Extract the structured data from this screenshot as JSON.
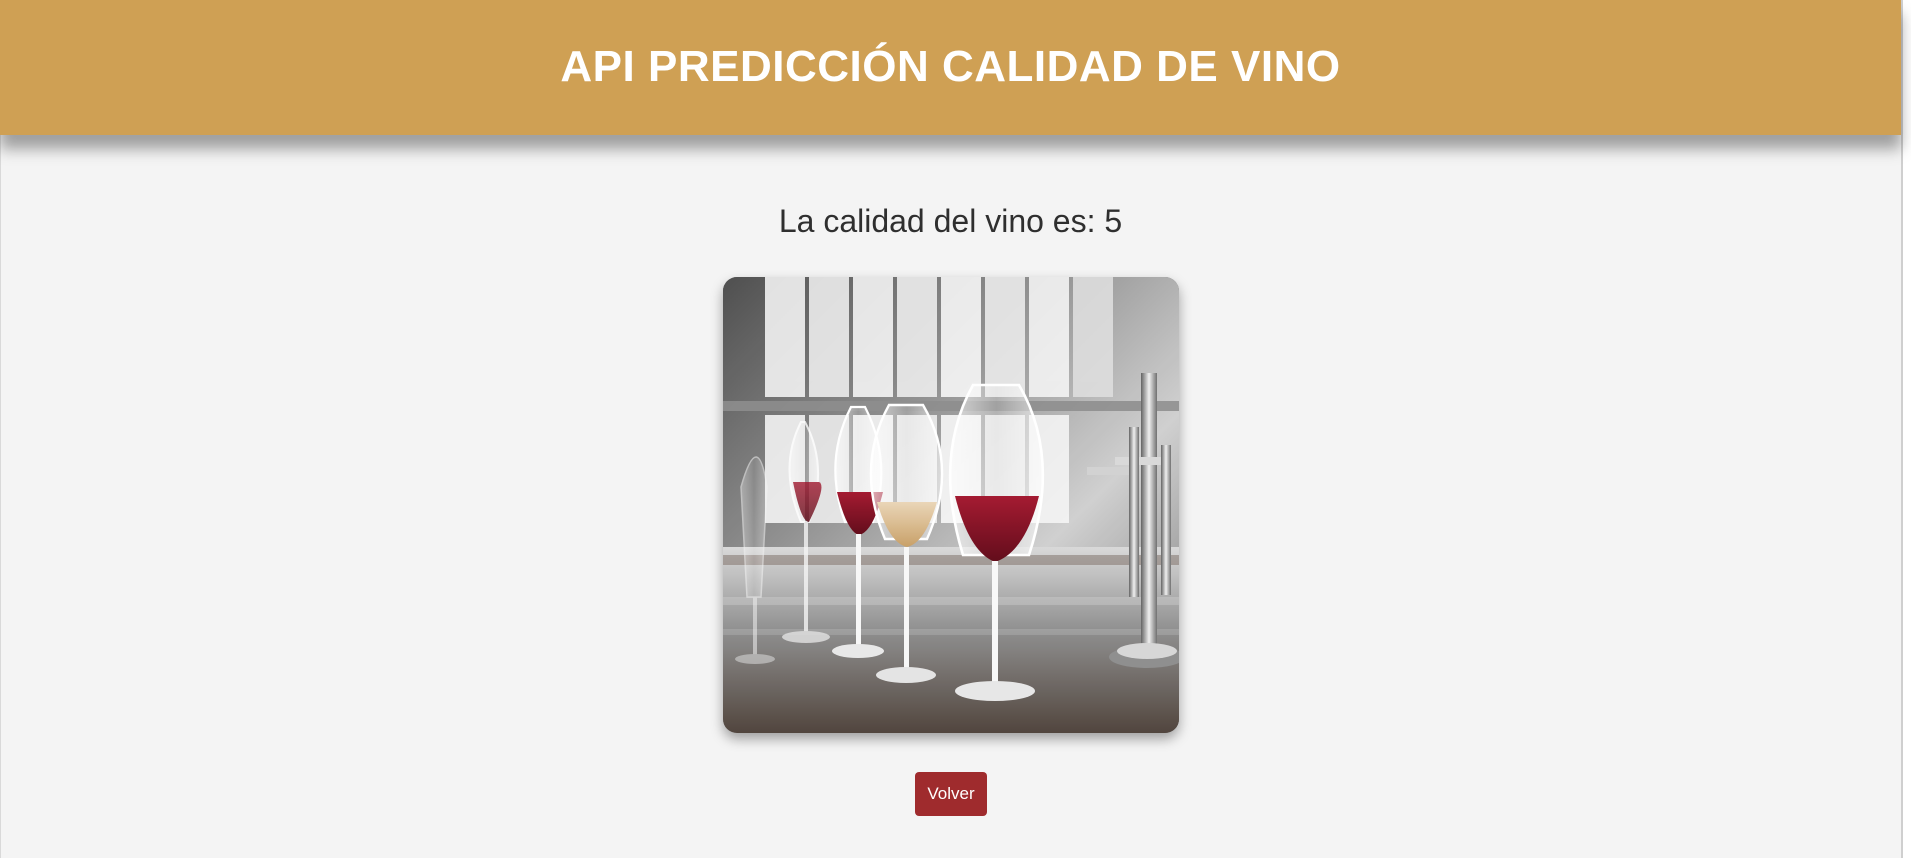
{
  "header": {
    "title": "API PREDICCIÓN CALIDAD DE VINO"
  },
  "result": {
    "text": "La calidad del vino es: 5"
  },
  "image": {
    "subject": "wine-glasses-in-lab"
  },
  "actions": {
    "back_label": "Volver"
  },
  "colors": {
    "header_background": "#cfa054",
    "page_background": "#f4f4f4",
    "button_background": "#9f2b2d"
  }
}
